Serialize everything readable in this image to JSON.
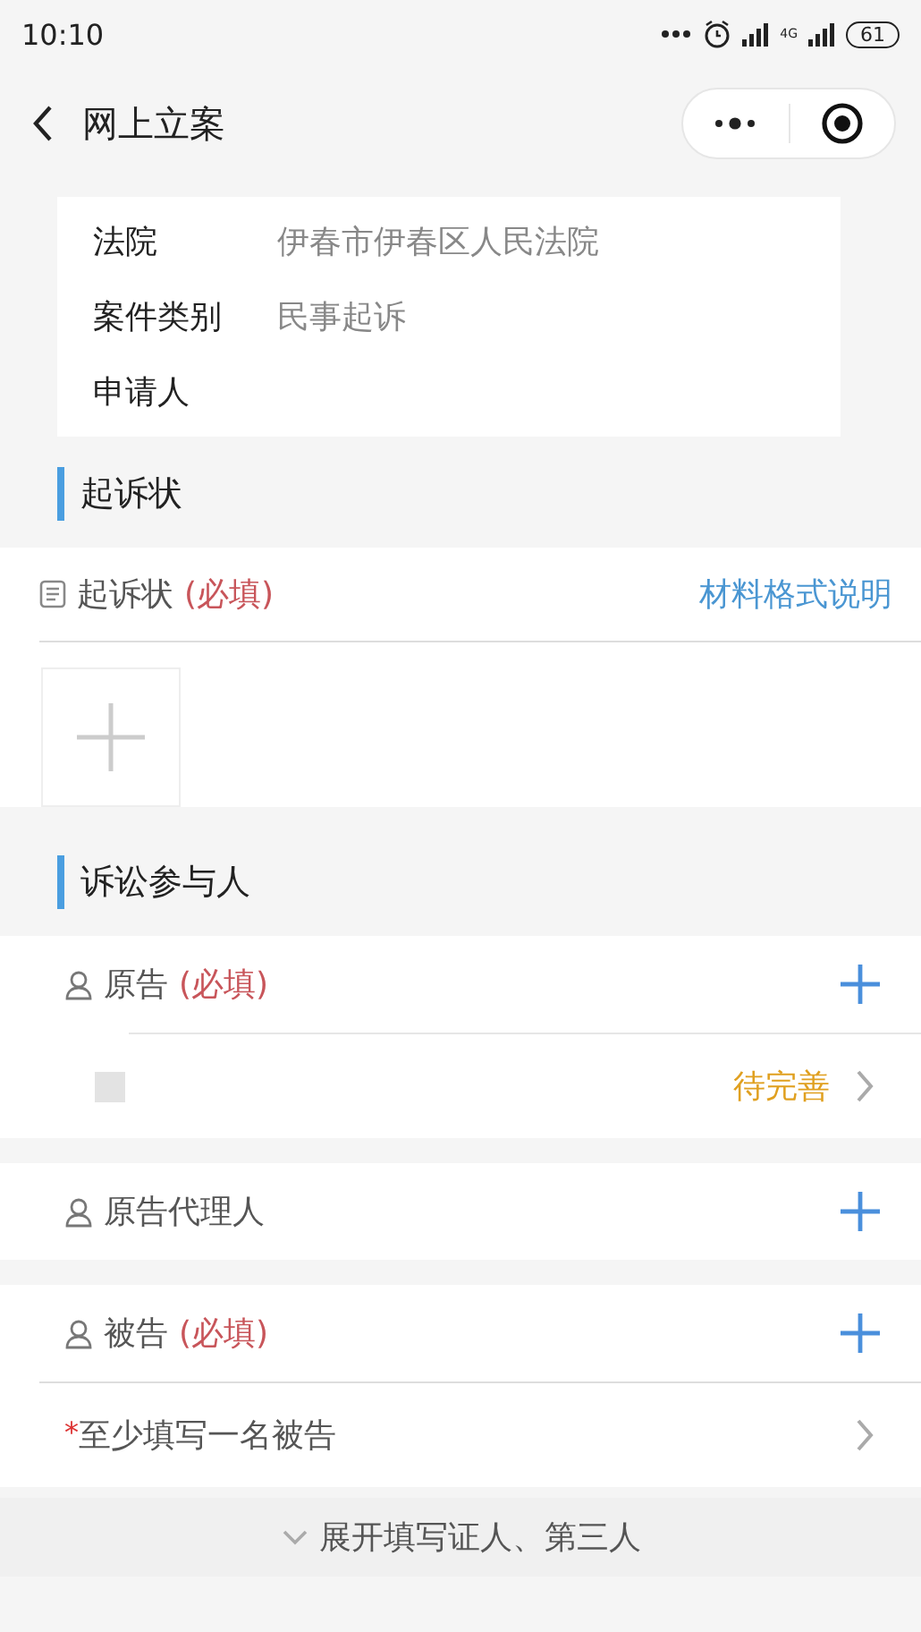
{
  "status_bar": {
    "time": "10:10",
    "network": "4G",
    "battery": "61"
  },
  "nav": {
    "title": "网上立案"
  },
  "case_info": [
    {
      "label": "法院",
      "value": "伊春市伊春区人民法院"
    },
    {
      "label": "案件类别",
      "value": "民事起诉"
    },
    {
      "label": "申请人"
    }
  ],
  "complaint": {
    "title": "起诉状",
    "label": "起诉状",
    "required": "(必填)",
    "link": "材料格式说明"
  },
  "participants": {
    "title": "诉讼参与人",
    "groups": [
      {
        "label": "原告",
        "required": "(必填)",
        "entries": [
          {
            "status": "待完善"
          }
        ]
      },
      {
        "label": "原告代理人"
      },
      {
        "label": "被告",
        "required": "(必填)",
        "hint": {
          "mark": "*",
          "text": "至少填写一名被告"
        }
      }
    ],
    "expand": "展开填写证人、第三人"
  }
}
